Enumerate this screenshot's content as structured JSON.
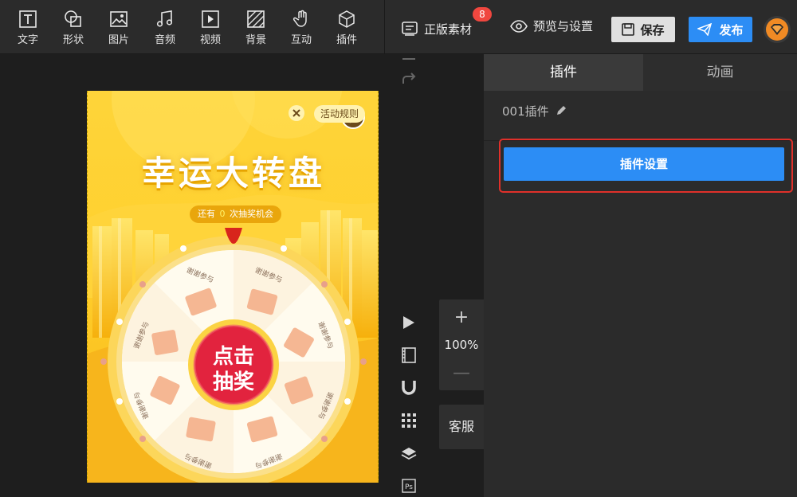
{
  "toolbar": {
    "tools": [
      {
        "label": "文字",
        "icon": "text-icon"
      },
      {
        "label": "形状",
        "icon": "shape-icon"
      },
      {
        "label": "图片",
        "icon": "image-icon"
      },
      {
        "label": "音频",
        "icon": "music-icon"
      },
      {
        "label": "视频",
        "icon": "video-icon"
      },
      {
        "label": "背景",
        "icon": "background-icon"
      },
      {
        "label": "互动",
        "icon": "hand-icon"
      },
      {
        "label": "插件",
        "icon": "cube-icon"
      }
    ],
    "assets_label": "正版素材",
    "assets_badge": "8",
    "preview_label": "预览与设置",
    "save_label": "保存",
    "publish_label": "发布"
  },
  "canvas": {
    "page": {
      "rules_label": "活动规则",
      "title": "幸运大转盘",
      "chances_prefix": "还有",
      "chances_count": "0",
      "chances_suffix": "次抽奖机会",
      "button_line1": "点击",
      "button_line2": "抽奖",
      "segment_label": "谢谢参与"
    },
    "zoom": "100%",
    "service_label": "客服"
  },
  "panel": {
    "tabs": [
      {
        "label": "插件",
        "active": true
      },
      {
        "label": "动画",
        "active": false
      }
    ],
    "plugin_name": "001插件",
    "plugin_settings_label": "插件设置"
  },
  "colors": {
    "accent_blue": "#2c8df5",
    "highlight_red": "#e0302a",
    "badge_red": "#f0473f",
    "page_yellow": "#fed43a",
    "wheel_rim": "#fcd65a",
    "lottery_button": "#e2233e"
  }
}
